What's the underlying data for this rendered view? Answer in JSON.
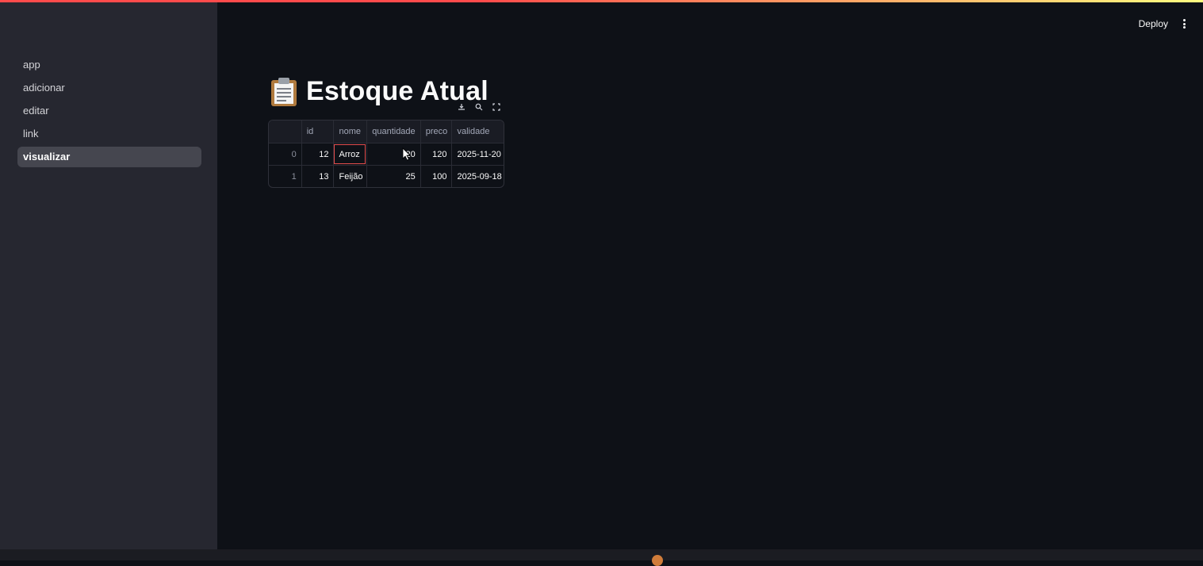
{
  "header": {
    "deploy_label": "Deploy"
  },
  "sidebar": {
    "items": [
      {
        "label": "app",
        "active": false
      },
      {
        "label": "adicionar",
        "active": false
      },
      {
        "label": "editar",
        "active": false
      },
      {
        "label": "link",
        "active": false
      },
      {
        "label": "visualizar",
        "active": true
      }
    ]
  },
  "page": {
    "title": "Estoque Atual",
    "title_icon": "clipboard-icon"
  },
  "table": {
    "toolbar_icons": [
      "download-icon",
      "search-icon",
      "fullscreen-icon"
    ],
    "columns": [
      "",
      "id",
      "nome",
      "quantidade",
      "preco",
      "validade"
    ],
    "rows": [
      {
        "index": "0",
        "id": "12",
        "nome": "Arroz",
        "quantidade": "20",
        "preco": "120",
        "validade": "2025-11-20"
      },
      {
        "index": "1",
        "id": "13",
        "nome": "Feijão",
        "quantidade": "25",
        "preco": "100",
        "validade": "2025-09-18"
      }
    ]
  },
  "colors": {
    "accent": "#ff4b4b",
    "background": "#0e1117",
    "sidebar": "#262730"
  }
}
